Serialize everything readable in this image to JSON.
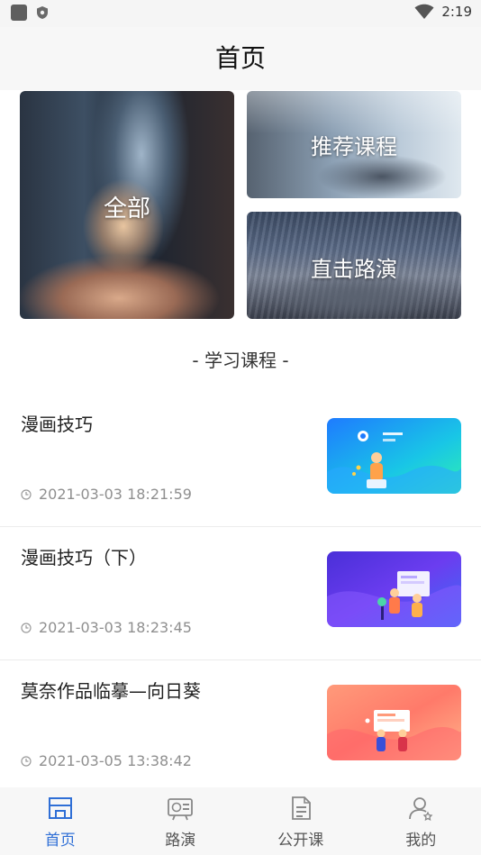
{
  "status_bar": {
    "time": "2:19"
  },
  "header": {
    "title": "首页"
  },
  "banners": {
    "all": "全部",
    "recommended": "推荐课程",
    "roadshow": "直击路演"
  },
  "section": {
    "title": "- 学习课程 -"
  },
  "courses": [
    {
      "name": "漫画技巧",
      "time": "2021-03-03 18:21:59"
    },
    {
      "name": "漫画技巧（下）",
      "time": "2021-03-03 18:23:45"
    },
    {
      "name": "莫奈作品临摹—向日葵",
      "time": "2021-03-05 13:38:42"
    }
  ],
  "bottom_nav": [
    {
      "label": "首页",
      "icon": "home-icon",
      "active": true
    },
    {
      "label": "路演",
      "icon": "roadshow-icon",
      "active": false
    },
    {
      "label": "公开课",
      "icon": "document-icon",
      "active": false
    },
    {
      "label": "我的",
      "icon": "profile-icon",
      "active": false
    }
  ],
  "colors": {
    "accent": "#2f6fd6",
    "inactive_nav": "#555555",
    "time_text": "#8f8f8f"
  }
}
